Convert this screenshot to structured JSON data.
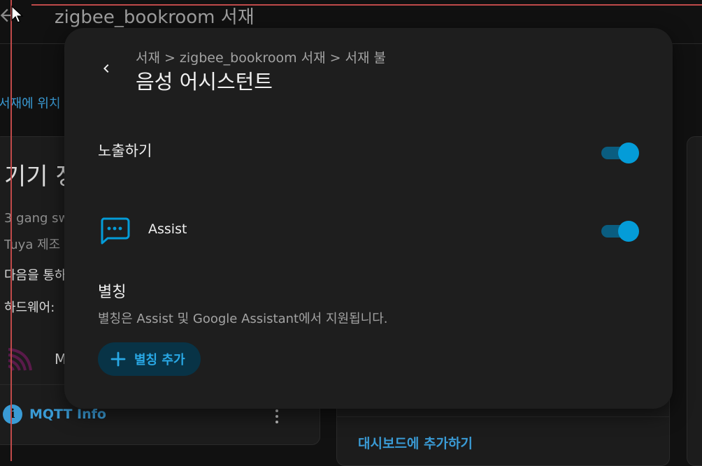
{
  "header": {
    "title": "zigbee_bookroom 서재"
  },
  "background": {
    "link_top": "서재에 위치",
    "heading": "기기 정",
    "lines": [
      "3 gang sw",
      "Tuya 제조",
      "다음을 통하",
      "하드웨어:"
    ],
    "mqtt_letter": "M",
    "info_link": "MQTT Info",
    "dashboard_link": "대시보드에 추가하기"
  },
  "dialog": {
    "breadcrumb": [
      "서재",
      "zigbee_bookroom 서재",
      "서재 불"
    ],
    "breadcrumb_separator": ">",
    "title": "음성 어시스턴트",
    "expose": {
      "label": "노출하기",
      "enabled": true
    },
    "assist": {
      "label": "Assist",
      "enabled": true
    },
    "aliases": {
      "title": "별칭",
      "description": "별칭은 Assist 및 Google Assistant에서 지원됩니다.",
      "add_button": "별칭 추가"
    }
  },
  "colors": {
    "accent": "#049cd8",
    "link": "#3a9bd5",
    "dialog_bg": "#1e1e1e",
    "page_bg": "#111111"
  }
}
